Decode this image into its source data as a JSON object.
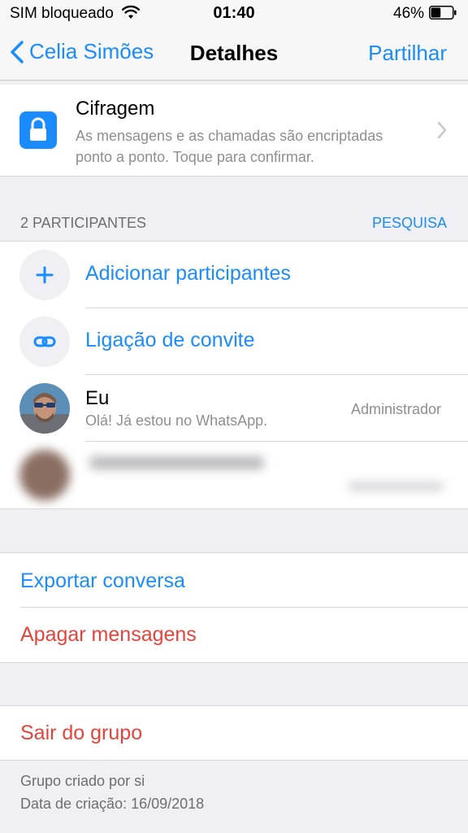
{
  "status_bar": {
    "carrier": "SIM bloqueado",
    "time": "01:40",
    "battery_percent": "46%",
    "battery_level": 0.46
  },
  "nav": {
    "back_label": "Celia Simões",
    "title": "Detalhes",
    "share_label": "Partilhar"
  },
  "encryption": {
    "title": "Cifragem",
    "description": "As mensagens e as chamadas são encriptadas ponto a ponto. Toque para confirmar."
  },
  "participants_section": {
    "header": "2 PARTICIPANTES",
    "search_label": "PESQUISA",
    "add_label": "Adicionar participantes",
    "invite_label": "Ligação de convite",
    "members": [
      {
        "name": "Eu",
        "status": "Olá! Já estou no WhatsApp.",
        "role": "Administrador"
      }
    ]
  },
  "actions": {
    "export_label": "Exportar conversa",
    "clear_label": "Apagar mensagens",
    "exit_label": "Sair do grupo"
  },
  "footer": {
    "created_by": "Grupo criado por si",
    "created_date": "Data de criação: 16/09/2018"
  },
  "colors": {
    "accent": "#1a8cff",
    "destructive": "#e8433b",
    "background": "#efeff4",
    "secondary_text": "#8e8e93"
  }
}
